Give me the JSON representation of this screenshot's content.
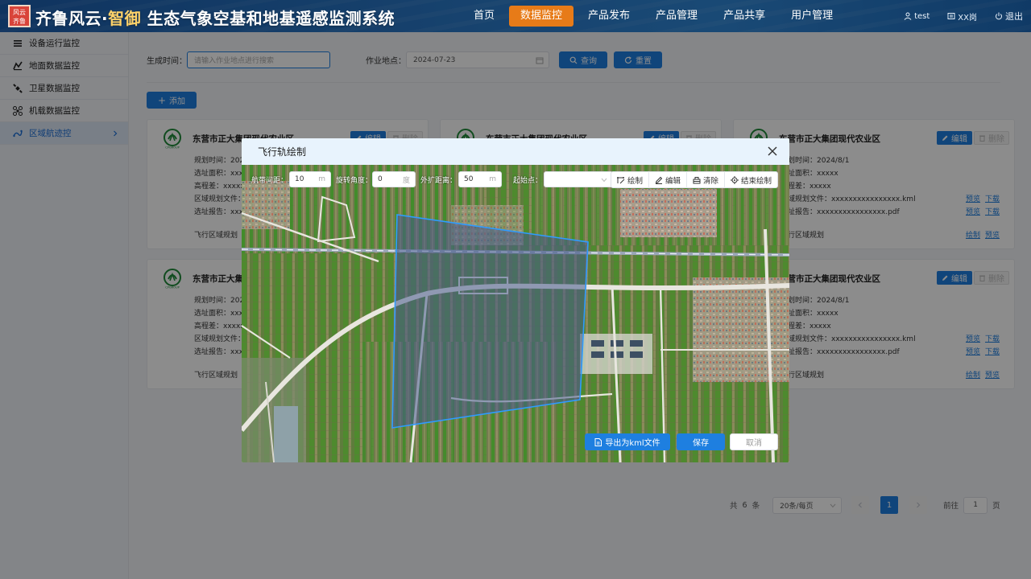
{
  "header": {
    "logo_text": "风云 齐鲁",
    "title_main": "齐鲁风云·",
    "title_accent": "智御",
    "title_rest": " 生态气象空基和地基遥感监测系统",
    "nav": [
      "首页",
      "数据监控",
      "产品发布",
      "产品管理",
      "产品共享",
      "用户管理"
    ],
    "active_nav": "数据监控",
    "user": "test",
    "role": "XX岗",
    "logout": "退出"
  },
  "sidebar": {
    "items": [
      {
        "label": "设备运行监控",
        "icon": "list-icon"
      },
      {
        "label": "地面数据监控",
        "icon": "ground-data-icon"
      },
      {
        "label": "卫星数据监控",
        "icon": "satellite-icon"
      },
      {
        "label": "机载数据监控",
        "icon": "drone-icon"
      },
      {
        "label": "区域航迹控",
        "icon": "route-icon"
      }
    ],
    "active": "区域航迹控"
  },
  "filter": {
    "time_label": "生成时间：",
    "time_placeholder": "请输入作业地点进行搜索",
    "location_label": "作业地点：",
    "location_value": "2024-07-23",
    "query": "查询",
    "reset": "重置"
  },
  "add_button": "添加",
  "card": {
    "title": "东营市正大集团现代农业区",
    "edit": "编辑",
    "delete": "删除",
    "plan_time_label": "规划时间：",
    "plan_time": "2024/8/1",
    "area_label": "选址面积：",
    "area": "xxxxx",
    "elev_label": "高程差：",
    "elev": "xxxxx",
    "region_file_label": "区域规划文件：",
    "region_file": "xxxxxxxxxxxxxxxx.kml",
    "report_label": "选址报告：",
    "report": "xxxxxxxxxxxxxxxx.pdf",
    "flight_label": "飞行区域规划",
    "preview": "预览",
    "download": "下载",
    "draw": "绘制",
    "logo_text": "CPGROUP"
  },
  "pagination": {
    "total_prefix": "共",
    "total": "6",
    "total_suffix": "条",
    "per_page": "20条/每页",
    "current": "1",
    "goto_prefix": "前往",
    "goto_value": "1",
    "goto_suffix": "页"
  },
  "dialog": {
    "title": "飞行轨绘制",
    "spacing_label": "航带间距：",
    "spacing_value": "10",
    "spacing_unit": "m",
    "rotation_label": "旋转角度：",
    "rotation_value": "0",
    "rotation_unit": "度",
    "expand_label": "外扩距离：",
    "expand_value": "50",
    "expand_unit": "m",
    "start_label": "起始点：",
    "start_value": "",
    "tools": [
      "绘制",
      "编辑",
      "清除",
      "结束绘制"
    ],
    "export": "导出为kml文件",
    "save": "保存",
    "cancel": "取消"
  },
  "colors": {
    "primary": "#1e7fe0",
    "nav_active": "#e77b18",
    "header": "#2a79c8"
  }
}
